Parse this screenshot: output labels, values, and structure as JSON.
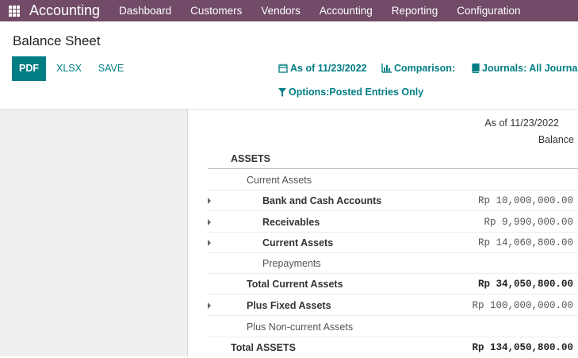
{
  "navbar": {
    "brand": "Accounting",
    "menu": [
      "Dashboard",
      "Customers",
      "Vendors",
      "Accounting",
      "Reporting",
      "Configuration"
    ]
  },
  "control": {
    "title": "Balance Sheet",
    "buttons": {
      "pdf": "PDF",
      "xlsx": "XLSX",
      "save": "SAVE"
    },
    "filters": {
      "date": "As of 11/23/2022",
      "comparison": "Comparison:",
      "journals": "Journals: All Journals",
      "options_label": "Options:",
      "options_value": "Posted Entries Only"
    }
  },
  "report": {
    "header_date": "As of 11/23/2022",
    "header_col": "Balance",
    "rows": [
      {
        "label": "ASSETS",
        "value": ""
      },
      {
        "label": "Current Assets",
        "value": ""
      },
      {
        "label": "Bank and Cash Accounts",
        "value": "Rp 10,000,000.00"
      },
      {
        "label": "Receivables",
        "value": "Rp 9,990,000.00"
      },
      {
        "label": "Current Assets",
        "value": "Rp 14,060,800.00"
      },
      {
        "label": "Prepayments",
        "value": ""
      },
      {
        "label": "Total Current Assets",
        "value": "Rp 34,050,800.00"
      },
      {
        "label": "Plus Fixed Assets",
        "value": "Rp 100,000,000.00"
      },
      {
        "label": "Plus Non-current Assets",
        "value": ""
      },
      {
        "label": "Total ASSETS",
        "value": "Rp 134,050,800.00"
      }
    ]
  },
  "colors": {
    "navbar": "#714b67",
    "accent": "#017e84"
  }
}
